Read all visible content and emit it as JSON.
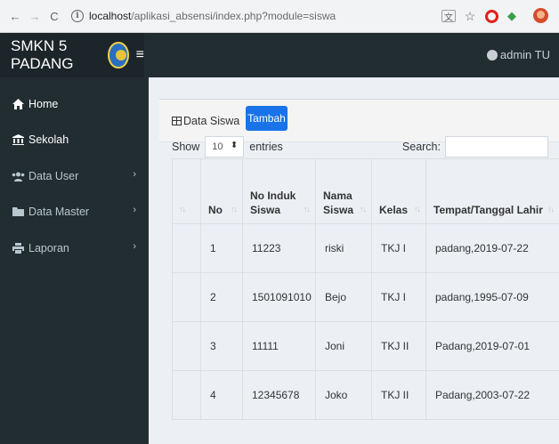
{
  "browser": {
    "url_host": "localhost",
    "url_path": "/aplikasi_absensi/index.php?module=siswa",
    "back_icon": "←",
    "forward_icon": "→",
    "reload_icon": "C",
    "info_icon": "i",
    "star_icon": "☆"
  },
  "header": {
    "brand": "SMKN 5 PADANG",
    "menu_icon": "≡",
    "user": "admin TU"
  },
  "sidebar": {
    "items": [
      {
        "label": "Home",
        "icon": "home-icon"
      },
      {
        "label": "Sekolah",
        "icon": "school-icon"
      },
      {
        "label": "Data User",
        "icon": "users-icon"
      },
      {
        "label": "Data Master",
        "icon": "folder-icon"
      },
      {
        "label": "Laporan",
        "icon": "print-icon"
      }
    ],
    "chevron": "›"
  },
  "main": {
    "tab_label": "Data Siswa",
    "add_button": "Tambah",
    "show_label": "Show",
    "entries_value": "10",
    "entries_label": "entries",
    "search_label": "Search:"
  },
  "table": {
    "columns": [
      "",
      "No",
      "No Induk Siswa",
      "Nama Siswa",
      "Kelas",
      "Tempat/Tanggal Lahir"
    ],
    "sort_icon": "↑↓",
    "rows": [
      [
        "",
        "1",
        "11223",
        "riski",
        "TKJ I",
        "padang,2019-07-22"
      ],
      [
        "",
        "2",
        "1501091010",
        "Bejo",
        "TKJ I",
        "padang,1995-07-09"
      ],
      [
        "",
        "3",
        "11111",
        "Joni",
        "TKJ II",
        "Padang,2019-07-01"
      ],
      [
        "",
        "4",
        "12345678",
        "Joko",
        "TKJ II",
        "Padang,2003-07-22"
      ]
    ]
  }
}
